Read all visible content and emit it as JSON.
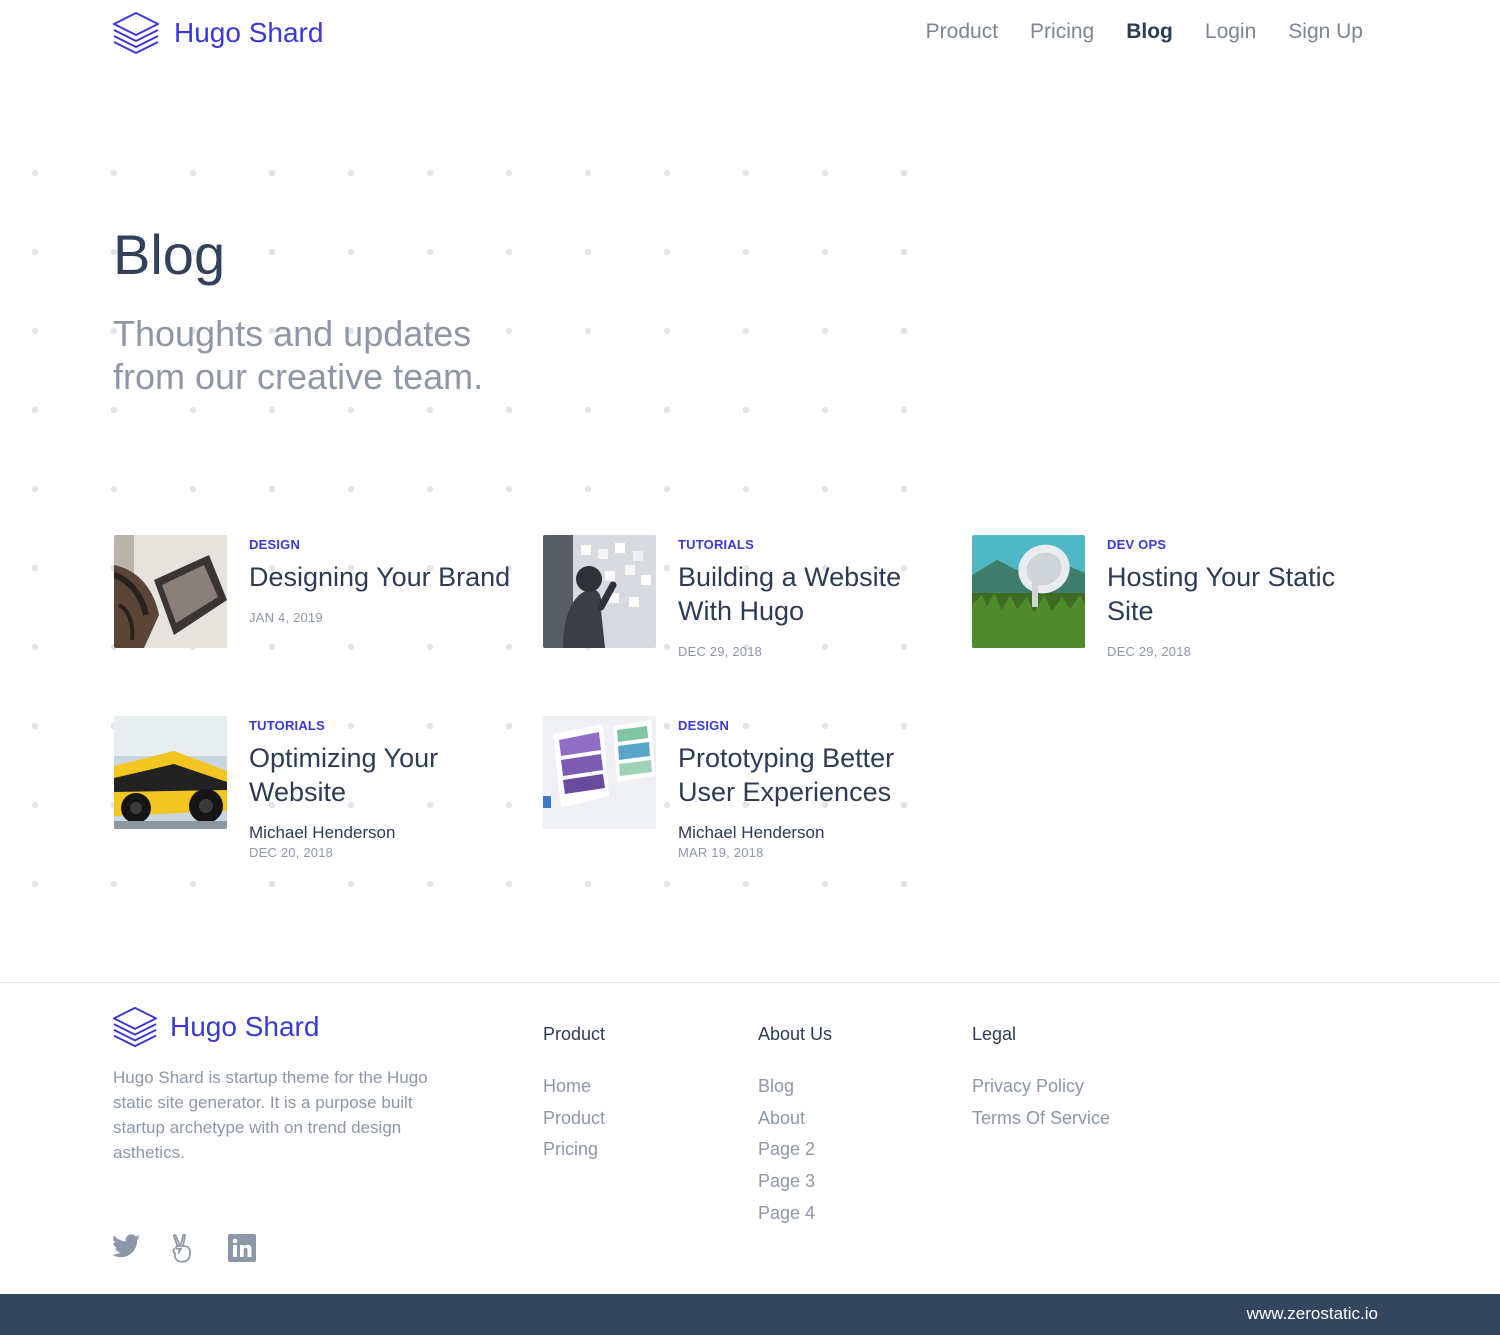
{
  "brand": {
    "name": "Hugo Shard",
    "logo_icon": "stacked-layers-icon",
    "color": "#3b39d4"
  },
  "nav": {
    "items": [
      {
        "label": "Product"
      },
      {
        "label": "Pricing"
      },
      {
        "label": "Blog",
        "active": true
      },
      {
        "label": "Login"
      },
      {
        "label": "Sign Up"
      }
    ]
  },
  "hero": {
    "title": "Blog",
    "subtitle": "Thoughts and updates from our creative team."
  },
  "posts": [
    {
      "category": "DESIGN",
      "title": "Designing Your Brand",
      "date": "JAN 4, 2019",
      "thumbnail": "tattooed-hands-sketching-image"
    },
    {
      "category": "TUTORIALS",
      "title": "Building a Website With Hugo",
      "date": "DEC 29, 2018",
      "thumbnail": "person-at-sticky-note-wall-image"
    },
    {
      "category": "DEV OPS",
      "title": "Hosting Your Static Site",
      "date": "DEC 29, 2018",
      "thumbnail": "satellite-dish-field-image"
    },
    {
      "category": "TUTORIALS",
      "title": "Optimizing Your Website",
      "author": "Michael Henderson",
      "date": "DEC 20, 2018",
      "thumbnail": "race-car-image"
    },
    {
      "category": "DESIGN",
      "title": "Prototyping Better User Experiences",
      "author": "Michael Henderson",
      "date": "MAR 19, 2018",
      "thumbnail": "paper-prototypes-image"
    }
  ],
  "footer": {
    "brand_name": "Hugo Shard",
    "description": "Hugo Shard is startup theme for the Hugo static site generator. It is a purpose built startup archetype with on trend design asthetics.",
    "columns": [
      {
        "heading": "Product",
        "links": [
          "Home",
          "Product",
          "Pricing"
        ]
      },
      {
        "heading": "About Us",
        "links": [
          "Blog",
          "About",
          "Page 2",
          "Page 3",
          "Page 4"
        ]
      },
      {
        "heading": "Legal",
        "links": [
          "Privacy Policy",
          "Terms Of Service"
        ]
      }
    ],
    "socials": [
      "twitter-icon",
      "angellist-icon",
      "linkedin-icon"
    ],
    "bottom_bar": {
      "text": "www.zerostatic.io",
      "color": "#34465f"
    }
  }
}
